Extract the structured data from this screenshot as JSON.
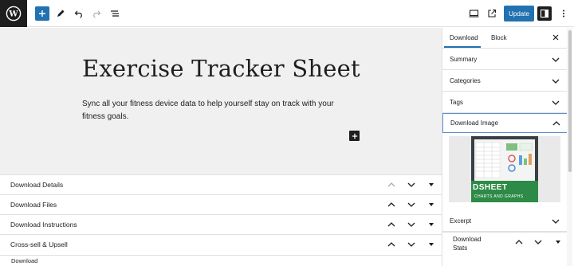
{
  "toolbar": {
    "logo_icon": "wordpress-logo",
    "add_block_icon": "plus-icon",
    "tools_icon": "pencil-icon",
    "undo_icon": "undo-icon",
    "redo_icon": "redo-icon",
    "outline_icon": "list-view-icon",
    "view_icon": "desktop-view-icon",
    "preview_icon": "external-link-icon",
    "update_label": "Update",
    "settings_icon": "sidebar-toggle-icon",
    "options_icon": "more-vertical-icon",
    "accent_color": "#2271b1"
  },
  "post": {
    "title": "Exercise Tracker Sheet",
    "paragraph": "Sync all your fitness device data to help yourself stay on track with your fitness goals."
  },
  "metaboxes": [
    {
      "label": "Download Details"
    },
    {
      "label": "Download Files"
    },
    {
      "label": "Download Instructions"
    },
    {
      "label": "Cross-sell & Upsell"
    }
  ],
  "footer": {
    "breadcrumb": "Download"
  },
  "sidebar": {
    "tabs": [
      {
        "label": "Download",
        "active": true
      },
      {
        "label": "Block",
        "active": false
      }
    ],
    "panels": [
      {
        "label": "Summary",
        "expanded": false
      },
      {
        "label": "Categories",
        "expanded": false
      },
      {
        "label": "Tags",
        "expanded": false
      },
      {
        "label": "Download Image",
        "expanded": true
      },
      {
        "label": "Excerpt",
        "expanded": false
      }
    ],
    "featured_image": {
      "banner_big": "DSHEET",
      "banner_small": "CHARTS AND GRAPHS"
    },
    "stats_panel": {
      "label": "Download Stats"
    }
  }
}
